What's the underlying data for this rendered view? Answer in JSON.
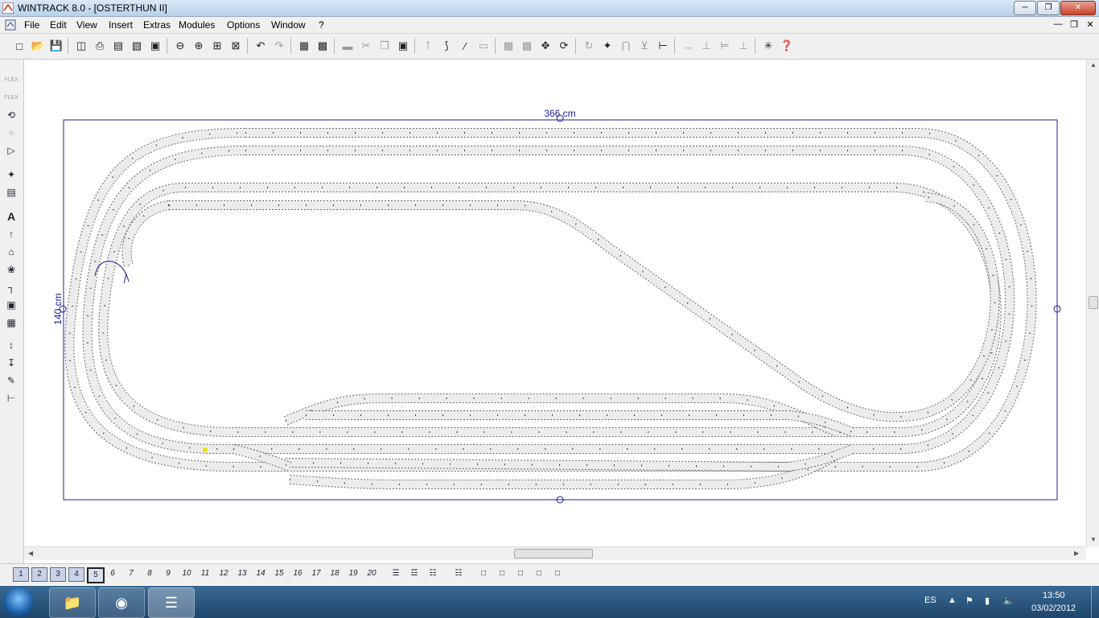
{
  "window": {
    "title": "WINTRACK 8.0 - [OSTERTHUN II]",
    "controls": [
      "minimize",
      "maximize",
      "close"
    ]
  },
  "menu": [
    "File",
    "Edit",
    "View",
    "Insert",
    "Extras",
    "Modules",
    "Options",
    "Window",
    "?"
  ],
  "toolbar_icons": [
    "new-icon",
    "open-icon",
    "save-icon",
    "print-preview-icon",
    "print-icon",
    "print-setup-icon",
    "layout-icon",
    "picture-icon",
    "zoom-out-icon",
    "zoom-in-icon",
    "zoom-window-icon",
    "zoom-all-icon",
    "undo-icon",
    "redo-icon",
    "parts-list-icon",
    "report-icon",
    "clipboard-icon",
    "cut-icon",
    "copy-icon",
    "paste-icon",
    "switch-icon",
    "curve-icon",
    "flex-track-icon",
    "align-icon",
    "group-icon",
    "ungroup-icon",
    "move-icon",
    "rotate-icon",
    "rotate-180-icon",
    "insert-track-icon",
    "connect-icon",
    "split-icon",
    "cut-track-icon",
    "join-icon",
    "bridge-icon",
    "grid-icon",
    "snap-icon",
    "measure-icon",
    "help-icon"
  ],
  "left_tools": [
    "FLEX",
    "FLEX",
    "A"
  ],
  "layout": {
    "width_label": "366 cm",
    "height_label": "140 cm"
  },
  "layers": [
    "1",
    "2",
    "3",
    "4",
    "5",
    "6",
    "7",
    "8",
    "9",
    "10",
    "11",
    "12",
    "13",
    "14",
    "15",
    "16",
    "17",
    "18",
    "19",
    "20"
  ],
  "active_layer": "5",
  "taskbar": {
    "language": "ES",
    "time": "13:50",
    "date": "03/02/2012",
    "apps": [
      "explorer-icon",
      "chrome-icon",
      "wintrack-icon"
    ]
  },
  "colors": {
    "board": "#1d1d9e",
    "track_fill": "#ececec",
    "track_edge": "#666666"
  }
}
